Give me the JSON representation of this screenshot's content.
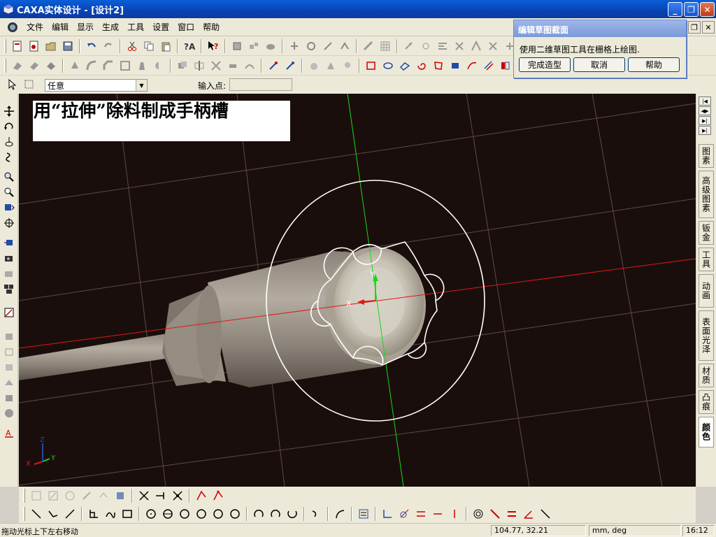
{
  "window": {
    "title": "CAXA实体设计 - [设计2]"
  },
  "menu": [
    "文件",
    "编辑",
    "显示",
    "生成",
    "工具",
    "设置",
    "窗口",
    "帮助"
  ],
  "selector": {
    "label": "任意"
  },
  "input": {
    "label": "输入点:"
  },
  "caption": "用“拉伸”除料制成手柄槽",
  "dialog": {
    "title": "编辑草图截面",
    "message": "使用二维草图工具在栅格上绘图.",
    "buttons": [
      "完成造型",
      "取消",
      "帮助"
    ]
  },
  "right_tabs": [
    "图素",
    "高级图素",
    "钣金",
    "工具",
    "动画",
    "表面光泽",
    "材质",
    "凸痕",
    "颜色"
  ],
  "axis_labels": {
    "x": "X",
    "y": "Y",
    "z": "Z"
  },
  "status": {
    "message": "拖动光标上下左右移动",
    "coords": "104.77, 32.21",
    "units": "mm, deg",
    "time": "16:12"
  },
  "colors": {
    "viewport_bg": "#1a0e0c",
    "x_axis": "#e01818",
    "y_axis": "#18d818",
    "sketch": "#ffffff",
    "title_bar": "#0a5fd8"
  }
}
